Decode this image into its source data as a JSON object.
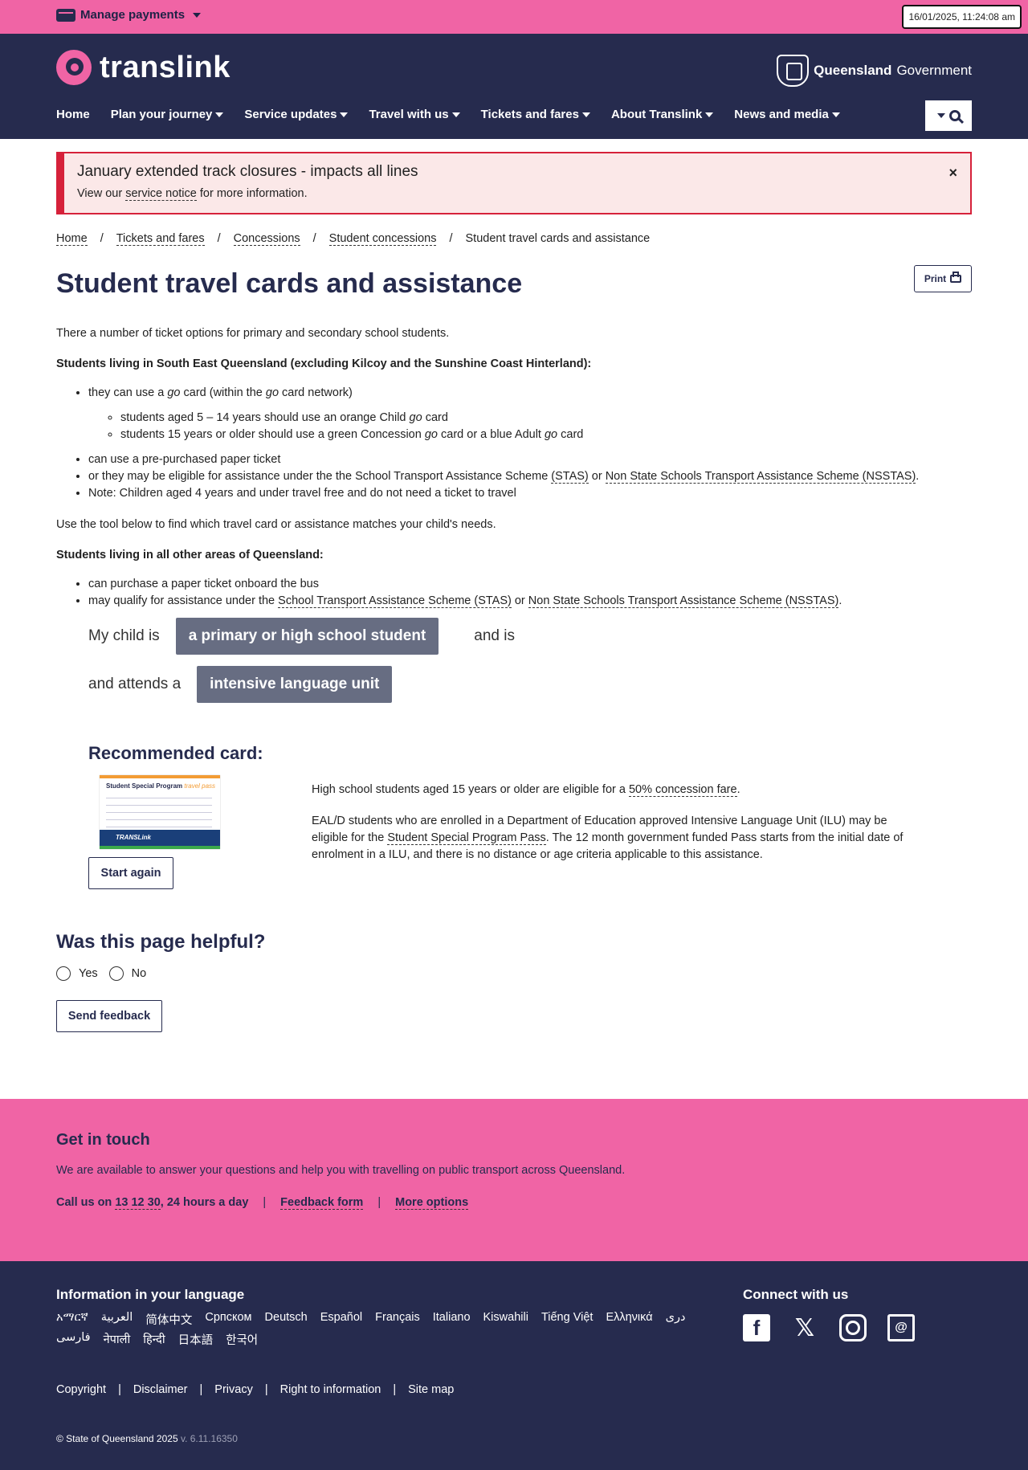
{
  "topbar": {
    "manage_label": "Manage payments",
    "datetime": "16/01/2025, 11:24:08 am"
  },
  "header": {
    "logo_text": "translink",
    "gov_bold": "Queensland",
    "gov_rest": " Government",
    "nav": [
      {
        "label": "Home",
        "dropdown": false
      },
      {
        "label": "Plan your journey",
        "dropdown": true
      },
      {
        "label": "Service updates",
        "dropdown": true
      },
      {
        "label": "Travel with us",
        "dropdown": true
      },
      {
        "label": "Tickets and fares",
        "dropdown": true
      },
      {
        "label": "About Translink",
        "dropdown": true
      },
      {
        "label": "News and media",
        "dropdown": true
      }
    ]
  },
  "alert": {
    "title": "January extended track closures - impacts all lines",
    "body_pre": "View our ",
    "link": "service notice",
    "body_post": " for more information.",
    "close": "×"
  },
  "breadcrumb": {
    "items": [
      "Home",
      "Tickets and fares",
      "Concessions",
      "Student concessions"
    ],
    "current": "Student travel cards and assistance",
    "sep": "/"
  },
  "page": {
    "title": "Student travel cards and assistance",
    "print_label": "Print",
    "intro": "There a number of ticket options for primary and secondary school students.",
    "seq_heading": "Students living in South East Queensland (excluding Kilcoy and the Sunshine Coast Hinterland):",
    "seq_item1_a": "they can use a ",
    "seq_item1_go": "go",
    "seq_item1_b": " card (within the ",
    "seq_item1_c": " card network)",
    "seq_sub1_a": "students aged 5 – 14 years should use an orange Child ",
    "seq_sub1_b": " card",
    "seq_sub2_a": "students 15 years or older should use a green Concession ",
    "seq_sub2_b": " card or a blue Adult ",
    "seq_sub2_c": " card",
    "seq_item2": "can use a pre-purchased paper ticket",
    "seq_item3_a": "or they may be eligible for assistance under the the School Transport Assistance Scheme ",
    "seq_item3_stas": "(STAS)",
    "seq_item3_or": " or ",
    "seq_item3_nsstas": "Non State Schools Transport Assistance Scheme (NSSTAS)",
    "seq_item3_end": ".",
    "seq_item4": "Note: Children aged 4 years and under travel free and do not need a ticket to travel",
    "tool_text": "Use the tool below to find which travel card or assistance matches your child's needs.",
    "other_heading": "Students living in all other areas of Queensland:",
    "other_item1": "can purchase a paper ticket onboard the bus",
    "other_item2_a": "may qualify for assistance under the ",
    "other_item2_stas": "School Transport Assistance Scheme (STAS)",
    "other_item2_or": " or ",
    "other_item2_nsstas": "Non State Schools Transport Assistance Scheme (NSSTAS)",
    "other_item2_end": "."
  },
  "selector": {
    "my_child_is": "My child is",
    "option1": "a primary or high school student",
    "and_is": "and is",
    "and_attends": "and attends a",
    "option2": "intensive language unit"
  },
  "recommended": {
    "heading": "Recommended card:",
    "card_title": "Student Special Program",
    "card_title_em": "travel pass",
    "card_brand": "TRANSLink",
    "p1_a": "High school students aged 15 years or older are eligible for a ",
    "p1_link": "50% concession fare",
    "p1_end": ".",
    "p2_a": "EAL/D students who are enrolled in a Department of Education approved Intensive Language Unit (ILU) may be eligible for the ",
    "p2_link": "Student Special Program Pass",
    "p2_b": ". The 12 month government funded Pass starts from the initial date of enrolment in a ILU, and there is no distance or age criteria applicable to this assistance.",
    "start_again": "Start again"
  },
  "feedback": {
    "heading": "Was this page helpful?",
    "yes": "Yes",
    "no": "No",
    "send": "Send feedback"
  },
  "touch": {
    "heading": "Get in touch",
    "text": "We are available to answer your questions and help you with travelling on public transport across Queensland.",
    "call_pre": "Call us on ",
    "phone": "13 12 30",
    "call_post": ", 24 hours a day",
    "feedback_form": "Feedback form",
    "more_options": "More options"
  },
  "footer": {
    "lang_heading": "Information in your language",
    "languages": [
      "አማርኛ",
      "العربية",
      "简体中文",
      "Српском",
      "Deutsch",
      "Español",
      "Français",
      "Italiano",
      "Kiswahili",
      "Tiếng Việt",
      "Ελληνικά",
      "دری",
      "فارسی",
      "नेपाली",
      "हिन्दी",
      "日本語",
      "한국어"
    ],
    "connect_heading": "Connect with us",
    "legal": [
      "Copyright",
      "Disclaimer",
      "Privacy",
      "Right to information",
      "Site map"
    ],
    "copyright": "© State of Queensland 2025",
    "version": " v. 6.11.16350"
  }
}
